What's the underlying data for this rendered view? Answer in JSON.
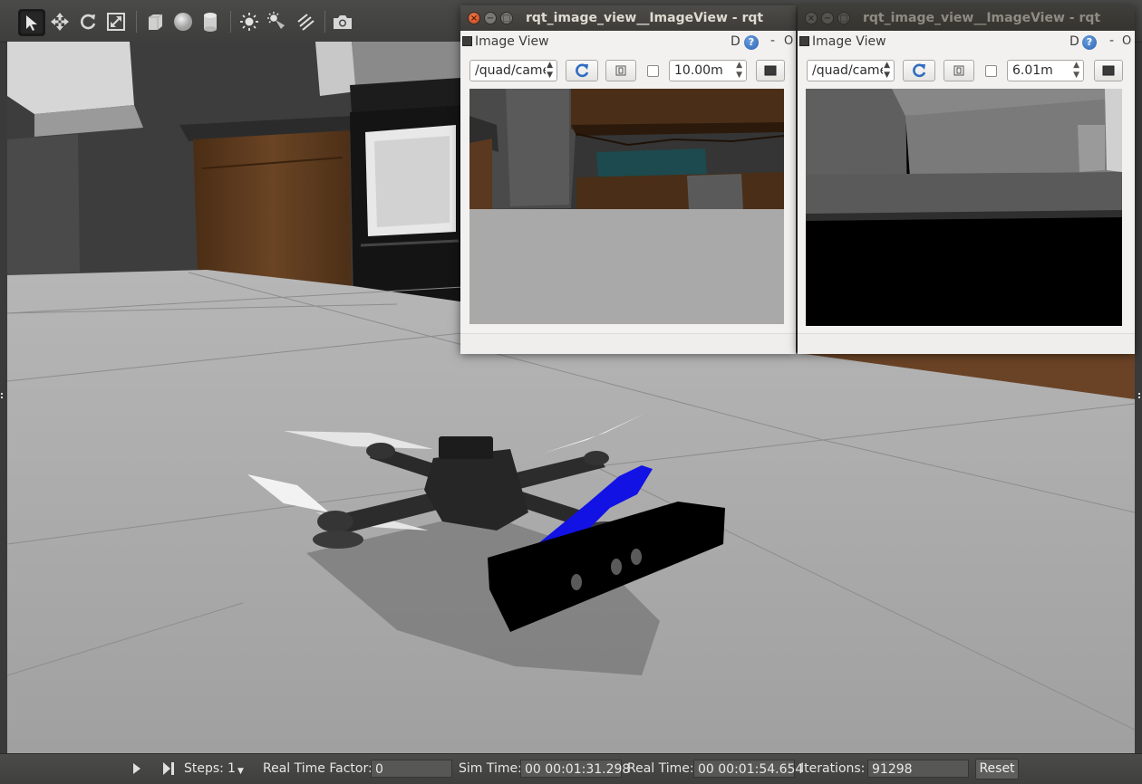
{
  "toolbar": {
    "tools": [
      {
        "name": "select-tool",
        "icon": "arrow-cursor-icon",
        "active": true
      },
      {
        "name": "translate-tool",
        "icon": "move-arrows-icon"
      },
      {
        "name": "rotate-tool",
        "icon": "rotate-icon"
      },
      {
        "name": "scale-tool",
        "icon": "scale-icon"
      },
      {
        "name": "box-shape",
        "icon": "box-icon"
      },
      {
        "name": "sphere-shape",
        "icon": "sphere-icon"
      },
      {
        "name": "cylinder-shape",
        "icon": "cylinder-icon"
      },
      {
        "name": "point-light",
        "icon": "point-light-icon"
      },
      {
        "name": "spot-light",
        "icon": "spot-light-icon"
      },
      {
        "name": "directional-light",
        "icon": "directional-light-icon"
      },
      {
        "name": "screenshot",
        "icon": "camera-icon"
      }
    ]
  },
  "rqt_windows": [
    {
      "title": "rqt_image_view__ImageView - rqt",
      "dock_label": "Image View",
      "dock_D": "D",
      "dock_min": "-",
      "dock_close": "O",
      "topic": "/quad/came",
      "max_range": "10.00m",
      "active": true
    },
    {
      "title": "rqt_image_view__ImageView - rqt",
      "dock_label": "Image View",
      "dock_D": "D",
      "dock_min": "-",
      "dock_close": "O",
      "topic": "/quad/came",
      "max_range": "6.01m",
      "active": false
    }
  ],
  "statusbar": {
    "steps_label": "Steps:",
    "steps_value": "1",
    "rtf_label": "Real Time Factor:",
    "rtf_value": "0",
    "sim_time_label": "Sim Time:",
    "sim_time_value": "00 00:01:31.298",
    "real_time_label": "Real Time:",
    "real_time_value": "00 00:01:54.654",
    "iterations_label": "Iterations:",
    "iterations_value": "91298",
    "reset_label": "Reset"
  },
  "colors": {
    "toolbar_bg": "#434341",
    "floor": "#a3a3a3",
    "wall": "#3d3d3d",
    "cabinet_wood": "#5a3a1f",
    "sensor_arm": "#1010e0",
    "sensor_bar": "#000000",
    "close_button": "#e0582a"
  }
}
